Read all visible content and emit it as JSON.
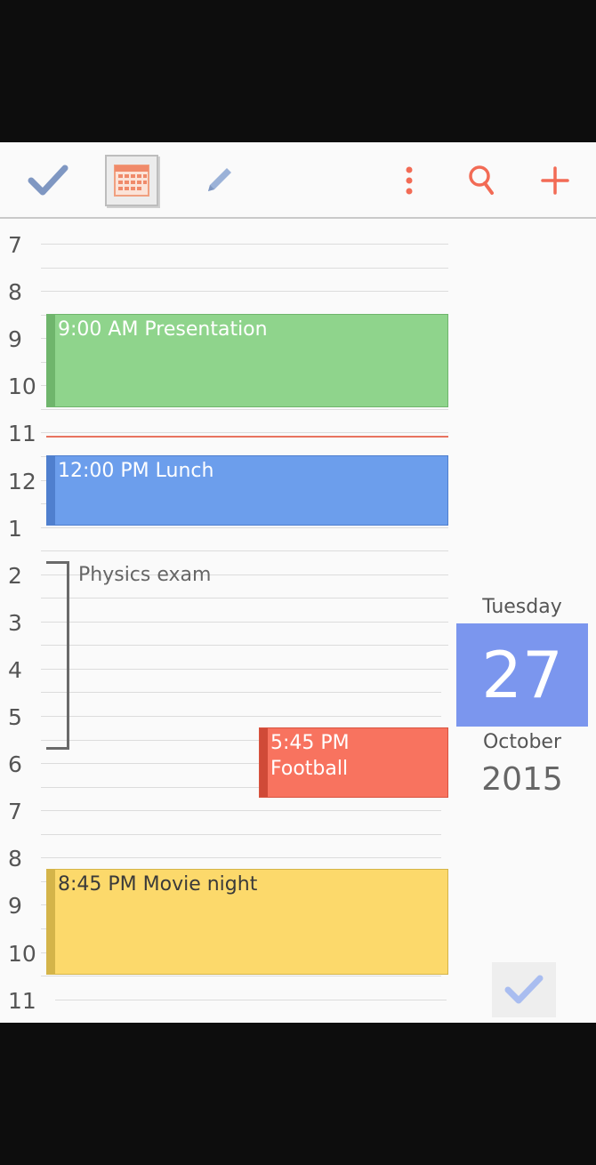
{
  "toolbar": {
    "icons": [
      "check-icon",
      "calendar-icon",
      "pencil-icon",
      "more-vert-icon",
      "search-icon",
      "plus-icon"
    ],
    "colors": {
      "accent": "#f26b55",
      "check": "#7f97c2",
      "pencil": "#9bb2d8"
    }
  },
  "timeline": {
    "hours": [
      "7",
      "8",
      "9",
      "10",
      "11",
      "12",
      "1",
      "2",
      "3",
      "4",
      "5",
      "6",
      "7",
      "8",
      "9",
      "10",
      "11"
    ],
    "events": [
      {
        "label": "9:00 AM Presentation",
        "color": "#8fd48c"
      },
      {
        "label": "12:00 PM Lunch",
        "color": "#6c9eec"
      },
      {
        "label": "5:45 PM\nFootball",
        "color": "#f8735f"
      },
      {
        "label": "8:45 PM Movie night",
        "color": "#fcd96b"
      }
    ],
    "all_day_range": {
      "label": "Physics exam"
    }
  },
  "date_panel": {
    "weekday": "Tuesday",
    "day": "27",
    "month": "October",
    "year": "2015",
    "accent": "#7b96ee"
  },
  "footer": {
    "done_icon": "check-icon"
  }
}
